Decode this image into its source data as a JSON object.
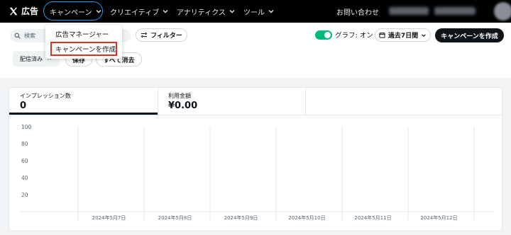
{
  "nav": {
    "logo_text": "広告",
    "items": [
      {
        "label": "キャンペーン",
        "active": true
      },
      {
        "label": "クリエイティブ"
      },
      {
        "label": "アナリティクス"
      },
      {
        "label": "ツール"
      }
    ],
    "help": "お問い合わせ"
  },
  "toolbar": {
    "search_placeholder": "検索",
    "filter_label": "フィルター",
    "graph_toggle_label": "グラフ: オン",
    "graph_on": true,
    "date_range_label": "過去7日間",
    "create_campaign_label": "キャンペーンを作成",
    "chip_label": "配信済み",
    "save_label": "保存",
    "clear_all_label": "すべて消去"
  },
  "dropdown": {
    "items": [
      "広告マネージャー",
      "キャンペーンを作成"
    ],
    "highlighted_index": 1
  },
  "metrics": [
    {
      "label": "インプレッション数",
      "value": "0",
      "active": true
    },
    {
      "label": "利用金額",
      "value": "¥0.00",
      "active": false
    }
  ],
  "chart_data": {
    "type": "line",
    "title": "",
    "xlabel": "",
    "ylabel": "",
    "y_ticks": [
      100,
      80,
      60,
      40,
      20
    ],
    "ylim": [
      0,
      100
    ],
    "categories": [
      "",
      "2024年5月7日",
      "2024年5月8日",
      "2024年5月9日",
      "2024年5月10日",
      "2024年5月11日",
      "2024年5月12日",
      ""
    ],
    "series": [],
    "grid": true,
    "colors": {
      "grid": "#e1e8ed",
      "axis_text": "#536471"
    }
  },
  "colors": {
    "nav_bg": "#000000",
    "active_outline": "#1d9bf0",
    "toggle_on": "#00ba7c",
    "cta_bg": "#0f1419",
    "highlight_box": "#e0301e"
  }
}
